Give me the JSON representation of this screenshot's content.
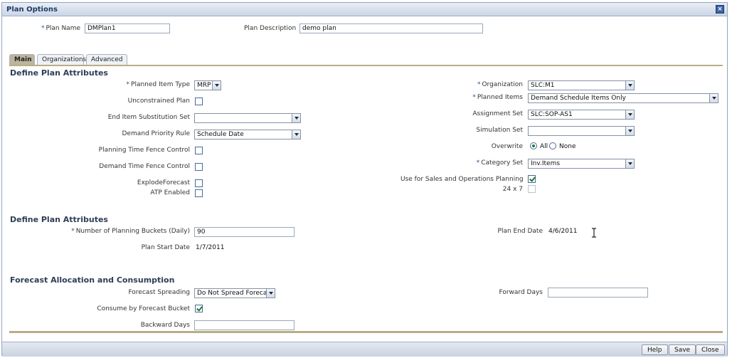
{
  "dialog": {
    "title": "Plan Options",
    "close_glyph": "×"
  },
  "header": {
    "plan_name_label": "Plan Name",
    "plan_name_value": "DMPlan1",
    "plan_description_label": "Plan Description",
    "plan_description_value": "demo plan"
  },
  "tabs": [
    {
      "label": "Main",
      "active": true
    },
    {
      "label": "Organizations",
      "active": false
    },
    {
      "label": "Advanced",
      "active": false
    }
  ],
  "section1": {
    "heading": "Define Plan Attributes",
    "planned_item_type": {
      "label": "Planned Item Type",
      "value": "MRP"
    },
    "unconstrained_plan": {
      "label": "Unconstrained Plan",
      "checked": false
    },
    "end_item_substitution_set": {
      "label": "End Item Substitution Set",
      "value": ""
    },
    "demand_priority_rule": {
      "label": "Demand Priority Rule",
      "value": "Schedule Date"
    },
    "planning_time_fence_control": {
      "label": "Planning Time Fence Control",
      "checked": false
    },
    "demand_time_fence_control": {
      "label": "Demand Time Fence Control",
      "checked": false
    },
    "explode_forecast": {
      "label": "ExplodeForecast",
      "checked": false
    },
    "atp_enabled": {
      "label": "ATP Enabled",
      "checked": false
    },
    "organization": {
      "label": "Organization",
      "value": "SLC:M1"
    },
    "planned_items": {
      "label": "Planned Items",
      "value": "Demand Schedule Items Only"
    },
    "assignment_set": {
      "label": "Assignment Set",
      "value": "SLC:SOP-AS1"
    },
    "simulation_set": {
      "label": "Simulation Set",
      "value": ""
    },
    "overwrite": {
      "label": "Overwrite",
      "options": [
        "All",
        "None"
      ],
      "selected": "All"
    },
    "category_set": {
      "label": "Category Set",
      "value": "Inv.Items"
    },
    "use_for_sop": {
      "label": "Use for Sales and Operations Planning",
      "checked": true
    },
    "twenty_four_by_seven": {
      "label": "24 x 7",
      "checked": false
    }
  },
  "section2": {
    "heading": "Define Plan Attributes",
    "number_of_planning_buckets": {
      "label": "Number of Planning Buckets (Daily)",
      "value": "90"
    },
    "plan_start_date": {
      "label": "Plan Start Date",
      "value": "1/7/2011"
    },
    "plan_end_date": {
      "label": "Plan End Date",
      "value": "4/6/2011"
    }
  },
  "section3": {
    "heading": "Forecast Allocation and Consumption",
    "forecast_spreading": {
      "label": "Forecast Spreading",
      "value": "Do Not Spread Forecast"
    },
    "consume_by_forecast_bucket": {
      "label": "Consume by Forecast Bucket",
      "checked": true
    },
    "backward_days": {
      "label": "Backward Days",
      "value": ""
    },
    "forward_days": {
      "label": "Forward Days",
      "value": ""
    }
  },
  "footer": {
    "help_label": "Help",
    "save_label": "Save",
    "close_label": "Close"
  },
  "required_marker": "*",
  "colors": {
    "accent": "#b9ac86",
    "title_text": "#1d3a64",
    "check_green": "#1f7a2f"
  }
}
